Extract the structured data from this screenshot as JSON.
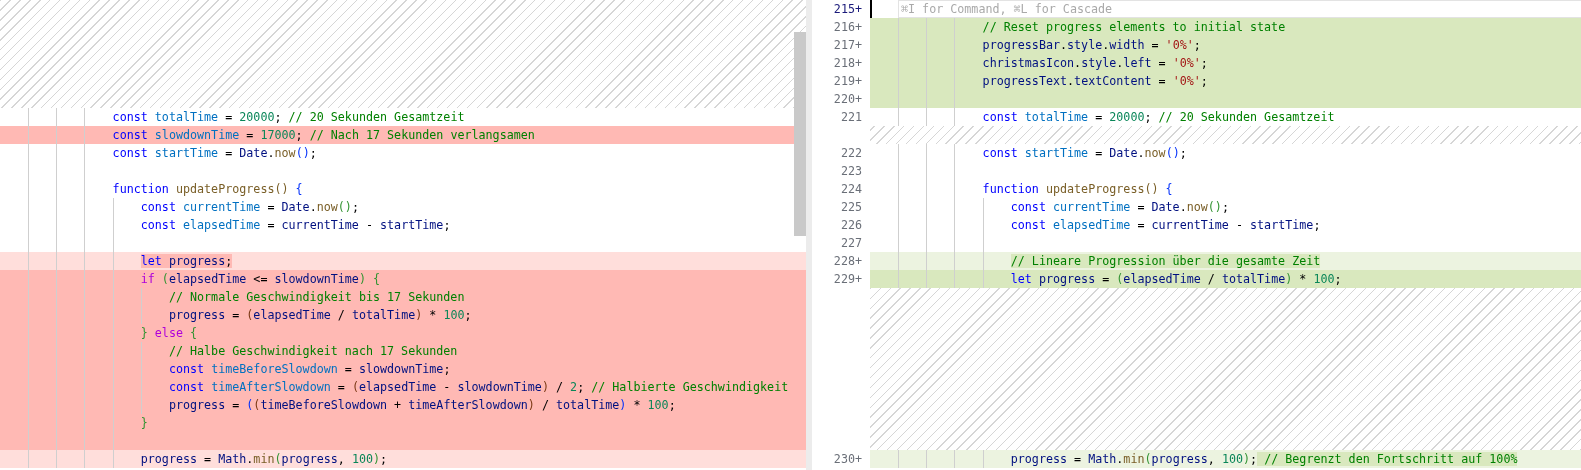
{
  "left": {
    "lines": [
      {
        "kind": "filler"
      },
      {
        "kind": "filler"
      },
      {
        "kind": "filler"
      },
      {
        "kind": "filler"
      },
      {
        "kind": "filler"
      },
      {
        "kind": "filler"
      },
      {
        "kind": "context",
        "tokens": [
          {
            "text": "                const ",
            "kind": "kw"
          },
          {
            "text": "totalTime",
            "kind": "def"
          },
          {
            "text": " = ",
            "kind": "p"
          },
          {
            "text": "20000",
            "kind": "num"
          },
          {
            "text": "; ",
            "kind": "p"
          },
          {
            "text": "// 20 Sekunden Gesamtzeit",
            "kind": "cmt"
          }
        ]
      },
      {
        "kind": "deleted",
        "full": true,
        "tokens": [
          {
            "text": "                const ",
            "kind": "kw"
          },
          {
            "text": "slowdownTime",
            "kind": "def"
          },
          {
            "text": " = ",
            "kind": "p"
          },
          {
            "text": "17000",
            "kind": "num"
          },
          {
            "text": "; ",
            "kind": "p"
          },
          {
            "text": "// Nach 17 Sekunden verlangsamen",
            "kind": "cmt"
          }
        ]
      },
      {
        "kind": "context",
        "tokens": [
          {
            "text": "                const ",
            "kind": "kw"
          },
          {
            "text": "startTime",
            "kind": "def"
          },
          {
            "text": " = ",
            "kind": "p"
          },
          {
            "text": "Date",
            "kind": "id"
          },
          {
            "text": ".",
            "kind": "p"
          },
          {
            "text": "now",
            "kind": "fn"
          },
          {
            "text": "()",
            "kind": "br1"
          },
          {
            "text": ";",
            "kind": "p"
          }
        ]
      },
      {
        "kind": "context"
      },
      {
        "kind": "context",
        "tokens": [
          {
            "text": "                function ",
            "kind": "kw"
          },
          {
            "text": "updateProgress",
            "kind": "fn"
          },
          {
            "text": "() ",
            "kind": "fn"
          },
          {
            "text": "{",
            "kind": "br1"
          }
        ]
      },
      {
        "kind": "context",
        "tokens": [
          {
            "text": "                    const ",
            "kind": "kw"
          },
          {
            "text": "currentTime",
            "kind": "def"
          },
          {
            "text": " = ",
            "kind": "p"
          },
          {
            "text": "Date",
            "kind": "id"
          },
          {
            "text": ".",
            "kind": "p"
          },
          {
            "text": "now",
            "kind": "fn"
          },
          {
            "text": "()",
            "kind": "br2"
          },
          {
            "text": ";",
            "kind": "p"
          }
        ]
      },
      {
        "kind": "context",
        "tokens": [
          {
            "text": "                    const ",
            "kind": "kw"
          },
          {
            "text": "elapsedTime",
            "kind": "def"
          },
          {
            "text": " = ",
            "kind": "p"
          },
          {
            "text": "currentTime",
            "kind": "id"
          },
          {
            "text": " - ",
            "kind": "p"
          },
          {
            "text": "startTime",
            "kind": "id"
          },
          {
            "text": ";",
            "kind": "p"
          }
        ]
      },
      {
        "kind": "context"
      },
      {
        "kind": "deleted",
        "full": false,
        "tokens": [
          {
            "text": "                    let ",
            "kind": "kw",
            "changed": true
          },
          {
            "text": "progress",
            "kind": "id",
            "changed": true
          },
          {
            "text": ";",
            "kind": "p",
            "changed": true
          }
        ]
      },
      {
        "kind": "deleted",
        "full": true,
        "tokens": [
          {
            "text": "                    if ",
            "kind": "ctrl"
          },
          {
            "text": "(",
            "kind": "br2"
          },
          {
            "text": "elapsedTime",
            "kind": "id"
          },
          {
            "text": " <= ",
            "kind": "p"
          },
          {
            "text": "slowdownTime",
            "kind": "id"
          },
          {
            "text": ") ",
            "kind": "br2"
          },
          {
            "text": "{",
            "kind": "br2"
          }
        ]
      },
      {
        "kind": "deleted",
        "full": true,
        "tokens": [
          {
            "text": "                        // Normale Geschwindigkeit bis 17 Sekunden",
            "kind": "cmt"
          }
        ]
      },
      {
        "kind": "deleted",
        "full": true,
        "tokens": [
          {
            "text": "                        progress",
            "kind": "id"
          },
          {
            "text": " = ",
            "kind": "p"
          },
          {
            "text": "(",
            "kind": "br3"
          },
          {
            "text": "elapsedTime",
            "kind": "id"
          },
          {
            "text": " / ",
            "kind": "p"
          },
          {
            "text": "totalTime",
            "kind": "id"
          },
          {
            "text": ")",
            "kind": "br3"
          },
          {
            "text": " * ",
            "kind": "p"
          },
          {
            "text": "100",
            "kind": "num"
          },
          {
            "text": ";",
            "kind": "p"
          }
        ]
      },
      {
        "kind": "deleted",
        "full": true,
        "tokens": [
          {
            "text": "                    } ",
            "kind": "br2"
          },
          {
            "text": "else ",
            "kind": "ctrl"
          },
          {
            "text": "{",
            "kind": "br2"
          }
        ]
      },
      {
        "kind": "deleted",
        "full": true,
        "tokens": [
          {
            "text": "                        // Halbe Geschwindigkeit nach 17 Sekunden",
            "kind": "cmt"
          }
        ]
      },
      {
        "kind": "deleted",
        "full": true,
        "tokens": [
          {
            "text": "                        const ",
            "kind": "kw"
          },
          {
            "text": "timeBeforeSlowdown",
            "kind": "def"
          },
          {
            "text": " = ",
            "kind": "p"
          },
          {
            "text": "slowdownTime",
            "kind": "id"
          },
          {
            "text": ";",
            "kind": "p"
          }
        ]
      },
      {
        "kind": "deleted",
        "full": true,
        "tokens": [
          {
            "text": "                        const ",
            "kind": "kw"
          },
          {
            "text": "timeAfterSlowdown",
            "kind": "def"
          },
          {
            "text": " = ",
            "kind": "p"
          },
          {
            "text": "(",
            "kind": "br3"
          },
          {
            "text": "elapsedTime",
            "kind": "id"
          },
          {
            "text": " - ",
            "kind": "p"
          },
          {
            "text": "slowdownTime",
            "kind": "id"
          },
          {
            "text": ")",
            "kind": "br3"
          },
          {
            "text": " / ",
            "kind": "p"
          },
          {
            "text": "2",
            "kind": "num"
          },
          {
            "text": "; ",
            "kind": "p"
          },
          {
            "text": "// Halbierte Geschwindigkeit",
            "kind": "cmt"
          }
        ]
      },
      {
        "kind": "deleted",
        "full": true,
        "tokens": [
          {
            "text": "                        progress",
            "kind": "id"
          },
          {
            "text": " = ",
            "kind": "p"
          },
          {
            "text": "(",
            "kind": "br1"
          },
          {
            "text": "(",
            "kind": "br3"
          },
          {
            "text": "timeBeforeSlowdown",
            "kind": "id"
          },
          {
            "text": " + ",
            "kind": "p"
          },
          {
            "text": "timeAfterSlowdown",
            "kind": "id"
          },
          {
            "text": ")",
            "kind": "br3"
          },
          {
            "text": " / ",
            "kind": "p"
          },
          {
            "text": "totalTime",
            "kind": "id"
          },
          {
            "text": ")",
            "kind": "br1"
          },
          {
            "text": " * ",
            "kind": "p"
          },
          {
            "text": "100",
            "kind": "num"
          },
          {
            "text": ";",
            "kind": "p"
          }
        ]
      },
      {
        "kind": "deleted",
        "full": true,
        "tokens": [
          {
            "text": "                    }",
            "kind": "br2"
          }
        ]
      },
      {
        "kind": "deleted",
        "full": true
      },
      {
        "kind": "deleted",
        "full": false,
        "tokens": [
          {
            "text": "                    progress",
            "kind": "id"
          },
          {
            "text": " = ",
            "kind": "p"
          },
          {
            "text": "Math",
            "kind": "id"
          },
          {
            "text": ".",
            "kind": "p"
          },
          {
            "text": "min",
            "kind": "fn"
          },
          {
            "text": "(",
            "kind": "br2"
          },
          {
            "text": "progress",
            "kind": "id"
          },
          {
            "text": ", ",
            "kind": "p"
          },
          {
            "text": "100",
            "kind": "num"
          },
          {
            "text": ")",
            "kind": "br2"
          },
          {
            "text": ";",
            "kind": "p"
          }
        ]
      }
    ]
  },
  "right": {
    "lines": [
      {
        "kind": "input",
        "number": "215+",
        "placeholder": "⌘I for Command, ⌘L for Cascade"
      },
      {
        "kind": "added",
        "full": true,
        "number": "216+",
        "tokens": [
          {
            "text": "                // Reset progress elements to initial state",
            "kind": "cmt"
          }
        ]
      },
      {
        "kind": "added",
        "full": true,
        "number": "217+",
        "tokens": [
          {
            "text": "                progressBar",
            "kind": "id"
          },
          {
            "text": ".",
            "kind": "p"
          },
          {
            "text": "style",
            "kind": "id"
          },
          {
            "text": ".",
            "kind": "p"
          },
          {
            "text": "width",
            "kind": "id"
          },
          {
            "text": " = ",
            "kind": "p"
          },
          {
            "text": "'0%'",
            "kind": "str"
          },
          {
            "text": ";",
            "kind": "p"
          }
        ]
      },
      {
        "kind": "added",
        "full": true,
        "number": "218+",
        "tokens": [
          {
            "text": "                christmasIcon",
            "kind": "id"
          },
          {
            "text": ".",
            "kind": "p"
          },
          {
            "text": "style",
            "kind": "id"
          },
          {
            "text": ".",
            "kind": "p"
          },
          {
            "text": "left",
            "kind": "id"
          },
          {
            "text": " = ",
            "kind": "p"
          },
          {
            "text": "'0%'",
            "kind": "str"
          },
          {
            "text": ";",
            "kind": "p"
          }
        ]
      },
      {
        "kind": "added",
        "full": true,
        "number": "219+",
        "tokens": [
          {
            "text": "                progressText",
            "kind": "id"
          },
          {
            "text": ".",
            "kind": "p"
          },
          {
            "text": "textContent",
            "kind": "id"
          },
          {
            "text": " = ",
            "kind": "p"
          },
          {
            "text": "'0%'",
            "kind": "str"
          },
          {
            "text": ";",
            "kind": "p"
          }
        ]
      },
      {
        "kind": "added",
        "full": true,
        "number": "220+"
      },
      {
        "kind": "context",
        "number": "221",
        "tokens": [
          {
            "text": "                const ",
            "kind": "kw"
          },
          {
            "text": "totalTime",
            "kind": "def"
          },
          {
            "text": " = ",
            "kind": "p"
          },
          {
            "text": "20000",
            "kind": "num"
          },
          {
            "text": "; ",
            "kind": "p"
          },
          {
            "text": "// 20 Sekunden Gesamtzeit",
            "kind": "cmt"
          }
        ]
      },
      {
        "kind": "filler"
      },
      {
        "kind": "context",
        "number": "222",
        "tokens": [
          {
            "text": "                const ",
            "kind": "kw"
          },
          {
            "text": "startTime",
            "kind": "def"
          },
          {
            "text": " = ",
            "kind": "p"
          },
          {
            "text": "Date",
            "kind": "id"
          },
          {
            "text": ".",
            "kind": "p"
          },
          {
            "text": "now",
            "kind": "fn"
          },
          {
            "text": "()",
            "kind": "br1"
          },
          {
            "text": ";",
            "kind": "p"
          }
        ]
      },
      {
        "kind": "context",
        "number": "223"
      },
      {
        "kind": "context",
        "number": "224",
        "tokens": [
          {
            "text": "                function ",
            "kind": "kw"
          },
          {
            "text": "updateProgress",
            "kind": "fn"
          },
          {
            "text": "() ",
            "kind": "fn"
          },
          {
            "text": "{",
            "kind": "br1"
          }
        ]
      },
      {
        "kind": "context",
        "number": "225",
        "tokens": [
          {
            "text": "                    const ",
            "kind": "kw"
          },
          {
            "text": "currentTime",
            "kind": "def"
          },
          {
            "text": " = ",
            "kind": "p"
          },
          {
            "text": "Date",
            "kind": "id"
          },
          {
            "text": ".",
            "kind": "p"
          },
          {
            "text": "now",
            "kind": "fn"
          },
          {
            "text": "()",
            "kind": "br2"
          },
          {
            "text": ";",
            "kind": "p"
          }
        ]
      },
      {
        "kind": "context",
        "number": "226",
        "tokens": [
          {
            "text": "                    const ",
            "kind": "kw"
          },
          {
            "text": "elapsedTime",
            "kind": "def"
          },
          {
            "text": " = ",
            "kind": "p"
          },
          {
            "text": "currentTime",
            "kind": "id"
          },
          {
            "text": " - ",
            "kind": "p"
          },
          {
            "text": "startTime",
            "kind": "id"
          },
          {
            "text": ";",
            "kind": "p"
          }
        ]
      },
      {
        "kind": "context",
        "number": "227"
      },
      {
        "kind": "added",
        "full": false,
        "number": "228+",
        "tokens": [
          {
            "text": "                    // Lineare Progression über die gesamte Zeit",
            "kind": "cmt",
            "changed": true
          }
        ]
      },
      {
        "kind": "added",
        "full": true,
        "number": "229+",
        "tokens": [
          {
            "text": "                    let ",
            "kind": "kw"
          },
          {
            "text": "progress",
            "kind": "id"
          },
          {
            "text": " = ",
            "kind": "p"
          },
          {
            "text": "(",
            "kind": "br2"
          },
          {
            "text": "elapsedTime",
            "kind": "id"
          },
          {
            "text": " / ",
            "kind": "p"
          },
          {
            "text": "totalTime",
            "kind": "id"
          },
          {
            "text": ")",
            "kind": "br2"
          },
          {
            "text": " * ",
            "kind": "p"
          },
          {
            "text": "100",
            "kind": "num"
          },
          {
            "text": ";",
            "kind": "p"
          }
        ]
      },
      {
        "kind": "filler"
      },
      {
        "kind": "filler"
      },
      {
        "kind": "filler"
      },
      {
        "kind": "filler"
      },
      {
        "kind": "filler"
      },
      {
        "kind": "filler"
      },
      {
        "kind": "filler"
      },
      {
        "kind": "filler"
      },
      {
        "kind": "filler"
      },
      {
        "kind": "added",
        "full": false,
        "number": "230+",
        "tokens": [
          {
            "text": "                    progress",
            "kind": "id"
          },
          {
            "text": " = ",
            "kind": "p"
          },
          {
            "text": "Math",
            "kind": "id"
          },
          {
            "text": ".",
            "kind": "p"
          },
          {
            "text": "min",
            "kind": "fn"
          },
          {
            "text": "(",
            "kind": "br2"
          },
          {
            "text": "progress",
            "kind": "id"
          },
          {
            "text": ", ",
            "kind": "p"
          },
          {
            "text": "100",
            "kind": "num"
          },
          {
            "text": ")",
            "kind": "br2"
          },
          {
            "text": ";",
            "kind": "p"
          },
          {
            "text": " // Begrenzt den Fortschritt auf 100%",
            "kind": "cmt",
            "changed": true
          }
        ]
      }
    ]
  }
}
